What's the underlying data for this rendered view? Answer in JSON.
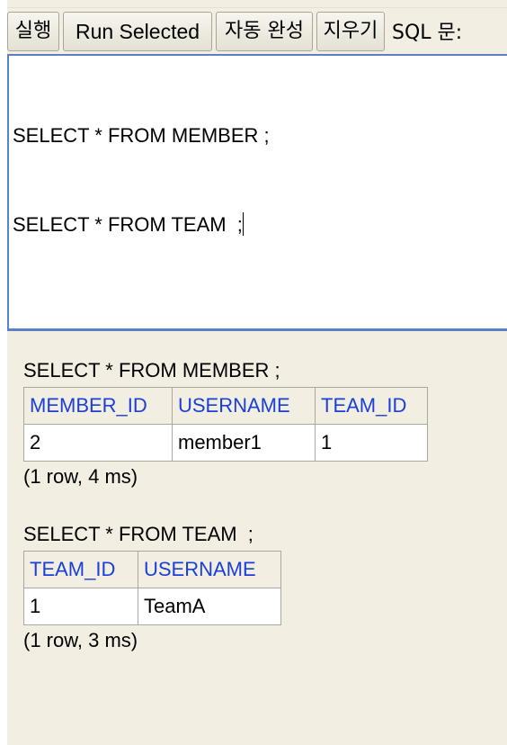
{
  "toolbar": {
    "execute_label": "실행",
    "run_selected_label": "Run Selected",
    "autocomplete_label": "자동 완성",
    "clear_label": "지우기",
    "sql_label": "SQL 문:"
  },
  "editor": {
    "lines": [
      "SELECT * FROM MEMBER ;",
      "SELECT * FROM TEAM  ;"
    ]
  },
  "results": [
    {
      "statement": "SELECT * FROM MEMBER ;",
      "columns": [
        "MEMBER_ID",
        "USERNAME",
        "TEAM_ID"
      ],
      "rows": [
        [
          "2",
          "member1",
          "1"
        ]
      ],
      "summary": "(1 row, 4 ms)"
    },
    {
      "statement": "SELECT * FROM TEAM  ;",
      "columns": [
        "TEAM_ID",
        "USERNAME"
      ],
      "rows": [
        [
          "1",
          "TeamA"
        ]
      ],
      "summary": "(1 row, 3 ms)"
    }
  ],
  "colors": {
    "background": "#f2efe2",
    "header_text": "#1a3fd6",
    "editor_border": "#5a80c8"
  }
}
